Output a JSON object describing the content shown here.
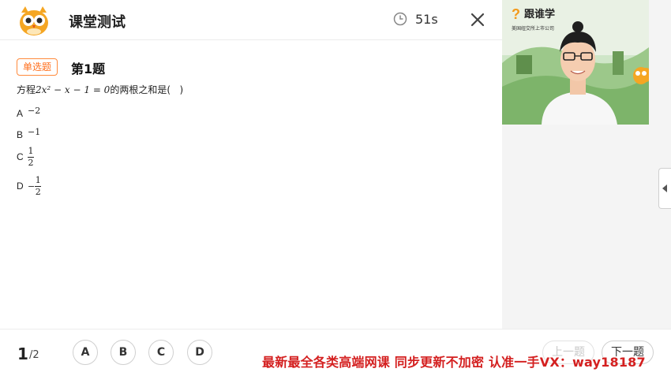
{
  "header": {
    "title": "课堂测试",
    "timer": "51s"
  },
  "question": {
    "type_badge": "单选题",
    "number_label": "第1题",
    "stem_prefix": "方程",
    "stem_math": "2x² − x − 1 = 0",
    "stem_suffix": "的两根之和是(   )",
    "options": [
      {
        "letter": "A",
        "value": "−2"
      },
      {
        "letter": "B",
        "value": "−1"
      },
      {
        "letter": "C",
        "num": "1",
        "den": "2"
      },
      {
        "letter": "D",
        "sign": "−",
        "num": "1",
        "den": "2"
      }
    ]
  },
  "video": {
    "brand": "跟谁学",
    "brand_sub": "美国纽交所上市公司"
  },
  "footer": {
    "page_current": "1",
    "page_total": "/2",
    "answers": [
      "A",
      "B",
      "C",
      "D"
    ],
    "prev_label": "上一题",
    "next_label": "下一题",
    "watermark": "最新最全各类高端网课 同步更新不加密 认准一手VX：way18187"
  },
  "colors": {
    "badge_orange": "#ff6d1a",
    "watermark_red": "#d42020",
    "brand_orange": "#f39a1c"
  }
}
